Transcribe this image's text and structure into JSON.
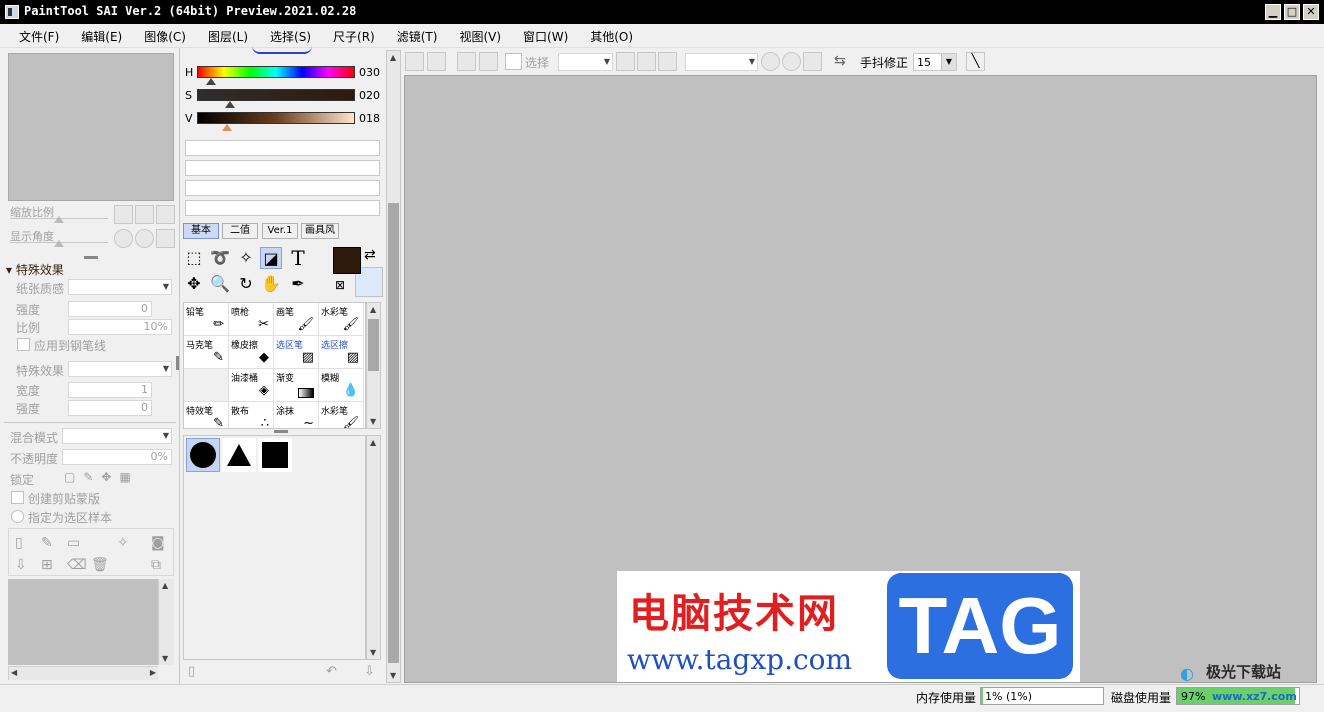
{
  "window": {
    "title": "PaintTool SAI Ver.2 (64bit) Preview.2021.02.28",
    "minimize": "▁",
    "maximize": "□",
    "close": "✕"
  },
  "menu": [
    {
      "label": "文件(F)"
    },
    {
      "label": "编辑(E)"
    },
    {
      "label": "图像(C)"
    },
    {
      "label": "图层(L)"
    },
    {
      "label": "选择(S)"
    },
    {
      "label": "尺子(R)"
    },
    {
      "label": "滤镜(T)"
    },
    {
      "label": "视图(V)"
    },
    {
      "label": "窗口(W)"
    },
    {
      "label": "其他(O)"
    }
  ],
  "navigator": {
    "zoom_label": "缩放比例",
    "angle_label": "显示角度"
  },
  "effects": {
    "header": "特殊效果",
    "paper_texture": "纸张质感",
    "strength": "强度",
    "strength_value": "0",
    "scale": "比例",
    "scale_value": "10%",
    "apply_pen": "应用到钢笔线",
    "effect": "特殊效果",
    "width": "宽度",
    "width_value": "1",
    "strength2": "强度",
    "strength2_value": "0"
  },
  "layer": {
    "blend_mode": "混合模式",
    "opacity": "不透明度",
    "opacity_value": "0%",
    "lock": "锁定",
    "clipping": "创建剪贴蒙版",
    "selection_source": "指定为选区样本"
  },
  "color": {
    "h_label": "H",
    "h_value": "030",
    "s_label": "S",
    "s_value": "020",
    "v_label": "V",
    "v_value": "018",
    "primary": "#2e1a0c",
    "secondary": "#dde9fa"
  },
  "brush_tabs": [
    {
      "label": "基本"
    },
    {
      "label": "二值"
    },
    {
      "label": "Ver.1"
    },
    {
      "label": "画具风"
    }
  ],
  "tools": {
    "text_icon": "T"
  },
  "brushes": [
    {
      "label": "铅笔"
    },
    {
      "label": "喷枪"
    },
    {
      "label": "画笔"
    },
    {
      "label": "水彩笔"
    },
    {
      "label": "马克笔"
    },
    {
      "label": "橡皮擦"
    },
    {
      "label": "选区笔"
    },
    {
      "label": "选区擦"
    },
    {
      "label": ""
    },
    {
      "label": "油漆桶"
    },
    {
      "label": "渐变"
    },
    {
      "label": "模糊"
    },
    {
      "label": "特效笔"
    },
    {
      "label": "散布"
    },
    {
      "label": "涂抹"
    },
    {
      "label": "水彩笔"
    }
  ],
  "toolbar": {
    "select_label": "选择",
    "stabilizer_label": "手抖修正",
    "stabilizer_value": "15"
  },
  "status": {
    "memory_label": "内存使用量",
    "memory_value": "1% (1%)",
    "disk_label": "磁盘使用量",
    "disk_value": "97%"
  },
  "watermark": {
    "site_name": "电脑技术网",
    "url": "www.tagxp.com",
    "tag": "TAG",
    "corner_text": "极光下载站",
    "corner_url": "www.xz7.com"
  }
}
